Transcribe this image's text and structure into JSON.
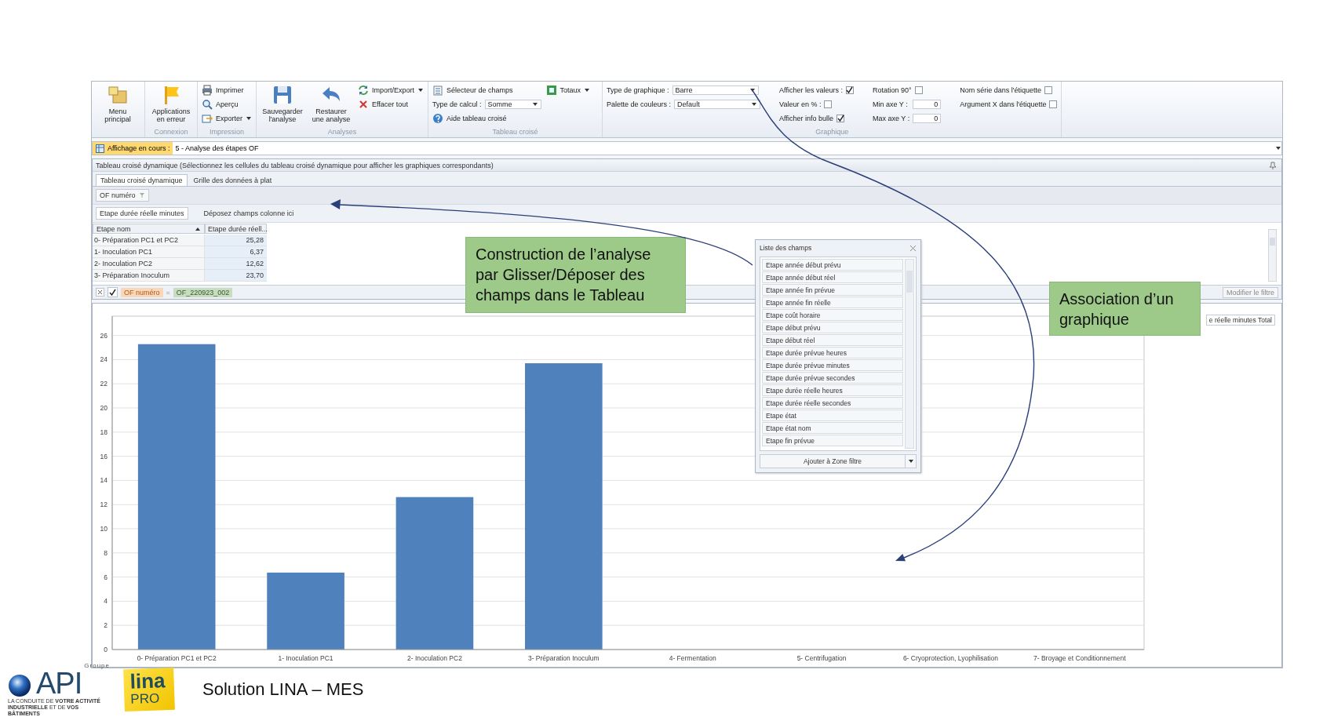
{
  "ribbon": {
    "groups": [
      {
        "columns": [
          [
            {
              "kind": "large",
              "label": "Menu principal"
            }
          ]
        ]
      },
      {
        "label": "Connexion",
        "columns": [
          [
            {
              "kind": "large",
              "label": "Applications en erreur"
            }
          ]
        ]
      },
      {
        "label": "Impression",
        "columns": [
          [
            {
              "kind": "small",
              "label": "Imprimer"
            },
            {
              "kind": "small",
              "label": "Aperçu"
            },
            {
              "kind": "dropdown",
              "label": "Exporter"
            }
          ]
        ]
      },
      {
        "label": "Analyses",
        "columns": [
          [
            {
              "kind": "large",
              "label": "Sauvegarder l'analyse"
            }
          ],
          [
            {
              "kind": "large",
              "label": "Restaurer une analyse"
            }
          ],
          [
            {
              "kind": "dropdown",
              "label": "Import/Export"
            },
            {
              "kind": "small",
              "label": "Effacer tout"
            }
          ]
        ]
      },
      {
        "label": "Tableau croisé",
        "columns": [
          [
            {
              "kind": "small",
              "label": "Sélecteur de champs"
            },
            {
              "kind": "combo",
              "label": "Type de calcul :",
              "value": "Somme"
            },
            {
              "kind": "small",
              "label": "Aide tableau croisé"
            }
          ],
          [
            {
              "kind": "dropdown",
              "label": "Totaux"
            }
          ]
        ]
      },
      {
        "label": "Graphique",
        "columns": [
          [
            {
              "kind": "combo",
              "label": "Type de graphique :",
              "value": "Barre"
            },
            {
              "kind": "combo",
              "label": "Palette de couleurs :",
              "value": "Default"
            }
          ],
          [
            {
              "kind": "check",
              "label": "Afficher les valeurs :",
              "checked": true
            },
            {
              "kind": "check",
              "label": "Valeur en % :",
              "checked": false
            },
            {
              "kind": "check",
              "label": "Afficher info bulle",
              "checked": true
            }
          ],
          [
            {
              "kind": "check",
              "label": "Rotation 90°",
              "checked": false
            },
            {
              "kind": "number",
              "label": "Min axe Y :",
              "value": "0"
            },
            {
              "kind": "number",
              "label": "Max axe Y :",
              "value": "0"
            }
          ],
          [
            {
              "kind": "check",
              "label": "Nom série dans l'étiquette",
              "checked": false
            },
            {
              "kind": "check",
              "label": "Argument X dans l'étiquette",
              "checked": false
            }
          ]
        ]
      }
    ]
  },
  "view_bar": {
    "label": "Affichage en cours :",
    "value": "5 - Analyse des étapes OF"
  },
  "pivot": {
    "title": "Tableau croisé dynamique (Sélectionnez les cellules du tableau croisé dynamique pour afficher les graphiques correspondants)",
    "tabs": [
      {
        "label": "Tableau croisé dynamique",
        "selected": true
      },
      {
        "label": "Grille des données à plat",
        "selected": false
      }
    ],
    "filter_fields": [
      "OF numéro"
    ],
    "data_fields": [
      "Etape durée réelle minutes"
    ],
    "column_drop_hint": "Déposez champs colonne ici",
    "row_field": {
      "label": "Etape nom",
      "sort_ascending": true
    },
    "value_header": "Etape durée réell...",
    "rows": [
      {
        "label": "0- Préparation PC1 et PC2",
        "value": "25,28"
      },
      {
        "label": "1- Inoculation PC1",
        "value": "6,37"
      },
      {
        "label": "2- Inoculation PC2",
        "value": "12,62"
      },
      {
        "label": "3- Préparation Inoculum",
        "value": "23,70"
      }
    ],
    "filter": {
      "enabled": true,
      "field": "OF numéro",
      "operator": "=",
      "value": "OF_220923_002",
      "edit_button": "Modifier le filtre"
    }
  },
  "chart": {
    "chart_data": {
      "type": "bar",
      "categories": [
        "0- Préparation PC1 et PC2",
        "1- Inoculation PC1",
        "2- Inoculation PC2",
        "3- Préparation Inoculum",
        "4- Fermentation",
        "5- Centrifugation",
        "6- Cryoprotection, Lyophilisation",
        "7- Broyage et Conditionnement"
      ],
      "series": [
        {
          "name": "e réelle minutes Total",
          "color": "#4f81bd",
          "values": [
            25.28,
            6.37,
            12.62,
            23.7,
            null,
            null,
            null,
            null
          ]
        }
      ],
      "grid": true,
      "ylim": [
        0,
        27.6
      ],
      "yticks": [
        0,
        2,
        4,
        6,
        8,
        10,
        12,
        14,
        16,
        18,
        20,
        22,
        24,
        26
      ]
    }
  },
  "field_list": {
    "title": "Liste des champs",
    "fields": [
      "Etape année début prévu",
      "Etape année début réel",
      "Etape année fin prévue",
      "Etape année fin réelle",
      "Etape coût horaire",
      "Etape début prévu",
      "Etape début réel",
      "Etape durée prévue heures",
      "Etape durée prévue minutes",
      "Etape durée prévue secondes",
      "Etape durée réelle heures",
      "Etape durée réelle secondes",
      "Etape état",
      "Etape état nom",
      "Etape fin prévue"
    ],
    "add_button": "Ajouter à Zone filtre"
  },
  "callouts": [
    {
      "text": "Construction de l’analyse par Glisser/Déposer des champs dans le Tableau"
    },
    {
      "text": "Association d’un graphique"
    }
  ],
  "footer": {
    "group_label": "Groupe",
    "company": "API",
    "tagline": "LA CONDUITE DE **VOTRE ACTIVITÉ INDUSTRIELLE** ET DE **VOS BÂTIMENTS**",
    "product": "lina",
    "product_edition": "PRO",
    "title": "Solution LINA – MES"
  }
}
